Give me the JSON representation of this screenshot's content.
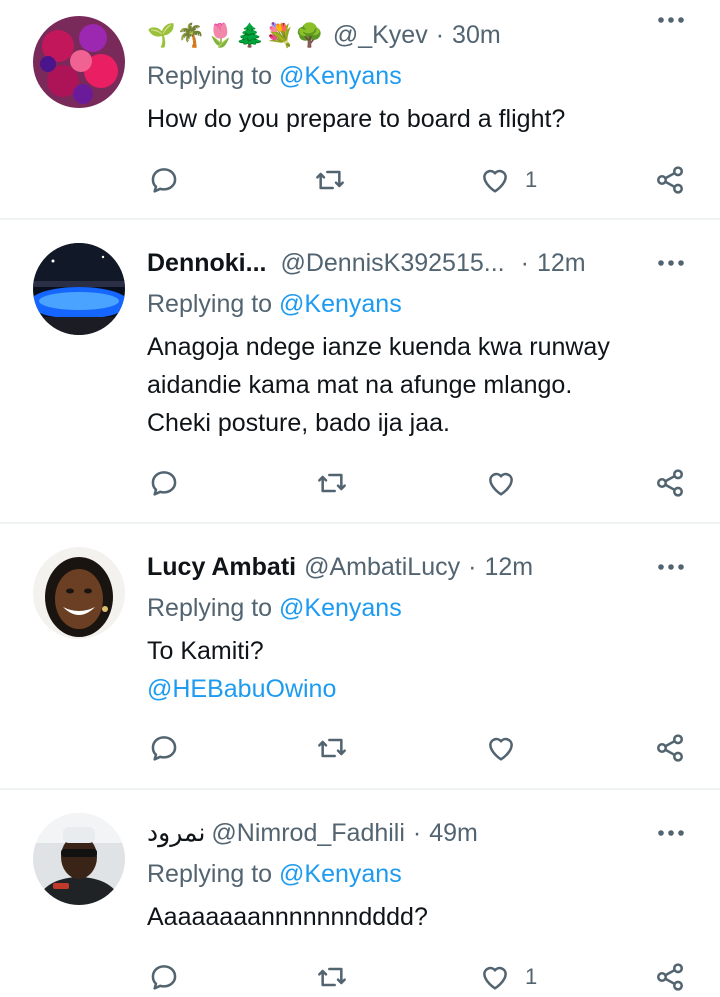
{
  "tweets": [
    {
      "name": "",
      "emojis": [
        "🌱",
        "🌴",
        "🌷",
        "🌲",
        "💐",
        "🌳"
      ],
      "handle": "@_Kyev",
      "time": "30m",
      "replying_prefix": "Replying to",
      "replying_to": "@Kenyans",
      "text_lines": [
        "How do you prepare to board a flight?"
      ],
      "mention": "",
      "likes": "1"
    },
    {
      "name": "Dennoki...",
      "emojis": [],
      "handle": "@DennisK392515...",
      "time": "12m",
      "replying_prefix": "Replying to",
      "replying_to": "@Kenyans",
      "text_lines": [
        "Anagoja ndege ianze kuenda kwa runway",
        "aidandie kama mat na afunge mlango.",
        "Cheki posture, bado ija jaa."
      ],
      "mention": "",
      "likes": ""
    },
    {
      "name": "Lucy Ambati",
      "emojis": [],
      "handle": "@AmbatiLucy",
      "time": "12m",
      "replying_prefix": "Replying to",
      "replying_to": "@Kenyans",
      "text_lines": [
        "To Kamiti?"
      ],
      "mention": "@HEBabuOwino",
      "likes": ""
    },
    {
      "name": "نمرود",
      "emojis": [],
      "handle": "@Nimrod_Fadhili",
      "time": "49m",
      "replying_prefix": "Replying to",
      "replying_to": "@Kenyans",
      "text_lines": [
        "Aaaaaaaannnnnnndddd?"
      ],
      "mention": "",
      "likes": "1"
    }
  ],
  "separator": "·",
  "icons": {
    "reply": "reply-icon",
    "retweet": "retweet-icon",
    "like": "heart-icon",
    "share": "share-icon",
    "more": "more-icon"
  },
  "colors": {
    "link": "#1d9bf0",
    "secondary_text": "#536471",
    "primary_text": "#0f1419",
    "divider": "#eff3f4"
  }
}
